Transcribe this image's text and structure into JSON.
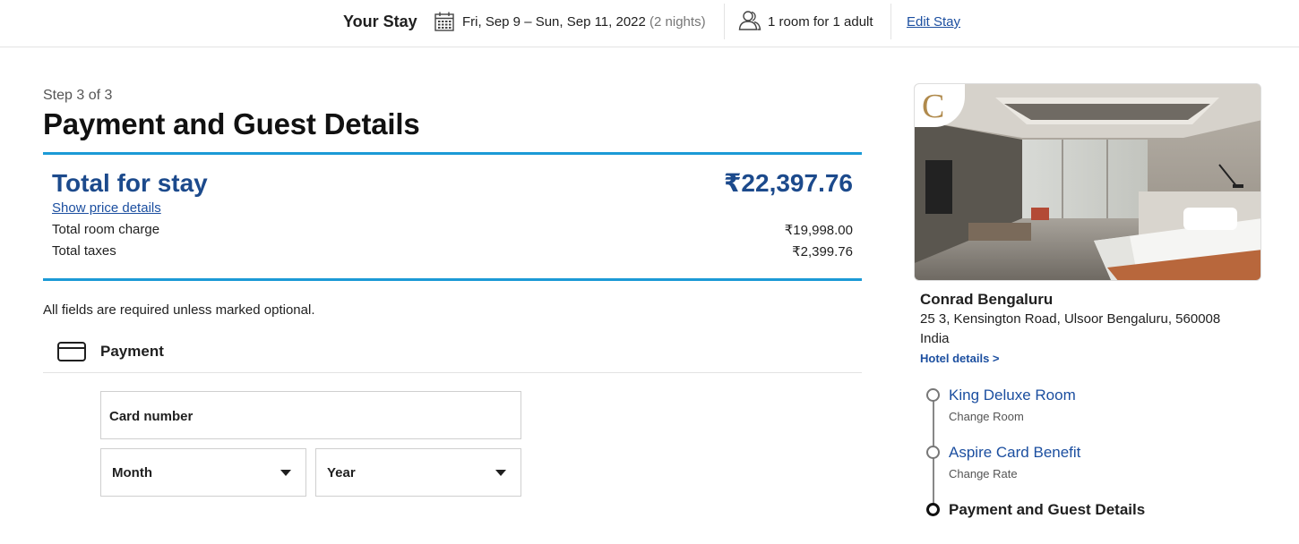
{
  "header": {
    "title": "Your Stay",
    "dates": "Fri, Sep 9 – Sun, Sep 11, 2022",
    "nights": "(2 nights)",
    "rooms": "1 room for 1 adult",
    "edit_label": "Edit Stay",
    "icons": [
      "calendar-icon",
      "guests-icon"
    ]
  },
  "main": {
    "step": "Step 3 of 3",
    "title": "Payment and Guest Details",
    "total": {
      "label": "Total for stay",
      "amount": "₹22,397.76",
      "details_link": "Show price details",
      "rows": [
        {
          "label": "Total room charge",
          "value": "₹19,998.00"
        },
        {
          "label": "Total taxes",
          "value": "₹2,399.76"
        }
      ]
    },
    "required_note": "All fields are required unless marked optional.",
    "payment": {
      "section_label": "Payment",
      "card_number_label": "Card number",
      "month_label": "Month",
      "year_label": "Year"
    }
  },
  "sidebar": {
    "hotel_name": "Conrad Bengaluru",
    "address_line1": "25 3, Kensington Road, Ulsoor Bengaluru, 560008",
    "address_line2": "India",
    "hotel_link": "Hotel details >",
    "brand_letter": "C",
    "timeline": [
      {
        "title": "King Deluxe Room",
        "action": "Change Room"
      },
      {
        "title": "Aspire Card Benefit",
        "action": "Change Rate"
      },
      {
        "title": "Payment and Guest Details"
      }
    ]
  },
  "colors": {
    "accent_blue": "#1b9ad6",
    "heading_blue": "#1c4a8c",
    "link_blue": "#1c4fa0",
    "brand_gold": "#b08a4c"
  }
}
